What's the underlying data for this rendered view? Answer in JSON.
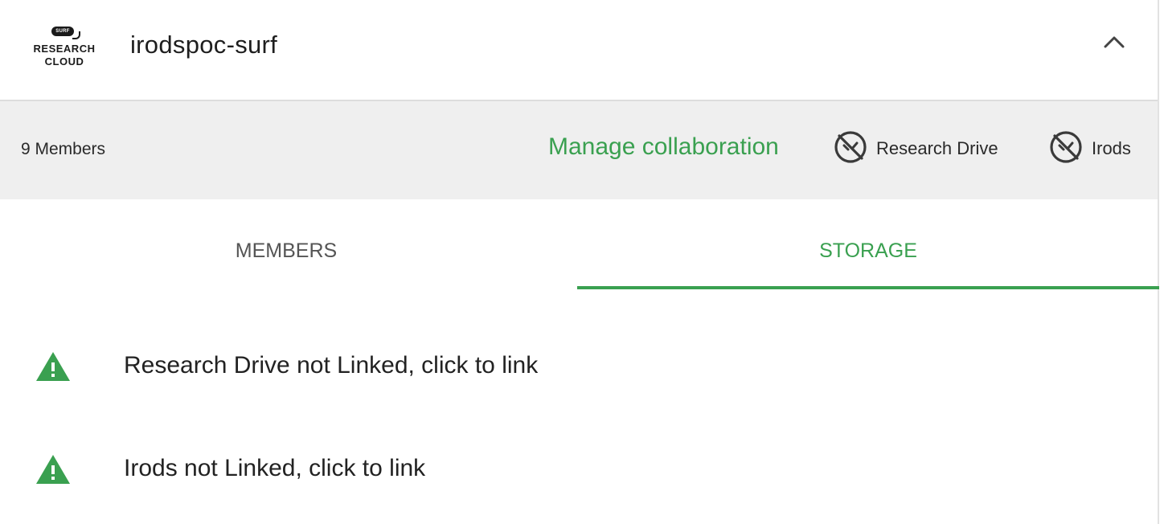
{
  "header": {
    "logo": {
      "badge": "SURF",
      "line1": "RESEARCH",
      "line2": "CLOUD"
    },
    "title": "irodspoc-surf",
    "collapse_icon": "chevron-up-icon"
  },
  "subbar": {
    "members_count": "9 Members",
    "manage_link": "Manage collaboration",
    "statuses": [
      {
        "icon": "disconnected-icon",
        "label": "Research Drive"
      },
      {
        "icon": "disconnected-icon",
        "label": "Irods"
      }
    ]
  },
  "tabs": [
    {
      "label": "MEMBERS",
      "active": false
    },
    {
      "label": "STORAGE",
      "active": true
    }
  ],
  "storage": {
    "items": [
      {
        "icon": "warning-icon",
        "text": "Research Drive not Linked, click to link"
      },
      {
        "icon": "warning-icon",
        "text": "Irods not Linked, click to link"
      }
    ]
  },
  "colors": {
    "accent": "#3aa050",
    "subbar_bg": "#efefef",
    "text": "#222222"
  }
}
